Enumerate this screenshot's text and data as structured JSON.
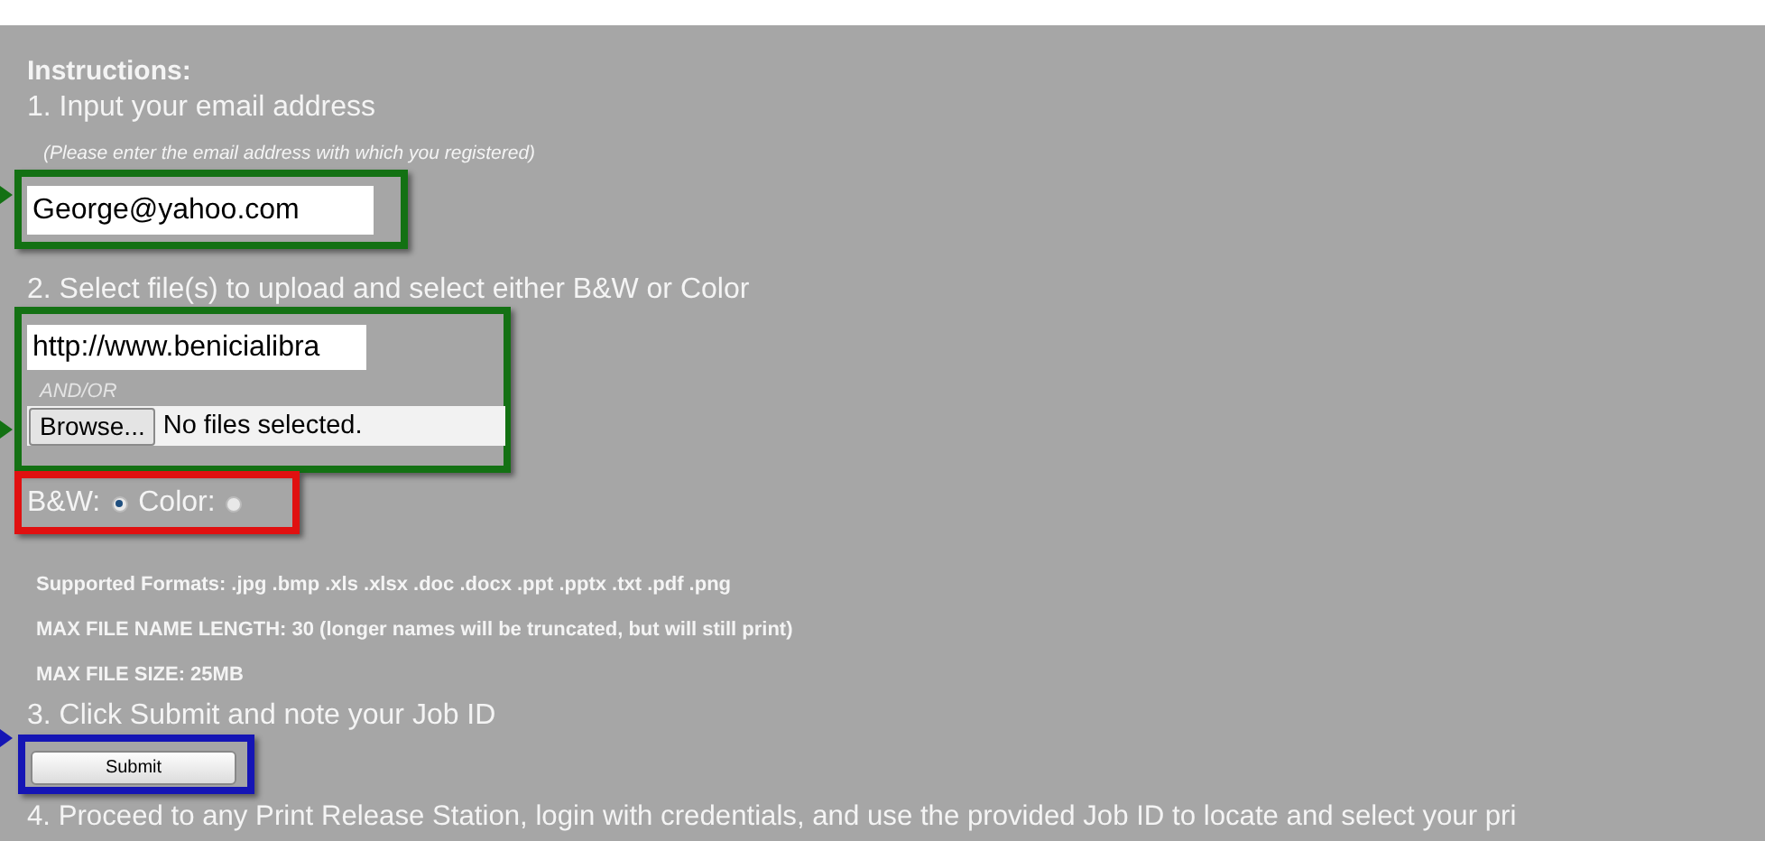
{
  "heading": "Instructions:",
  "email": {
    "step": "1. Input your email address",
    "hint": "(Please enter the email address with which you registered)",
    "value": "George@yahoo.com",
    "highlight": {
      "color": "#137113"
    }
  },
  "files": {
    "step": "2. Select file(s) to upload and select either B&W or Color",
    "url_value": "http://www.benicialibra",
    "separator": "AND/OR",
    "browse_button": "Browse...",
    "file_status": "No files selected.",
    "highlight": {
      "color": "#137113"
    }
  },
  "print_mode": {
    "options": [
      {
        "label": "B&W:",
        "selected": true
      },
      {
        "label": "Color:",
        "selected": false
      }
    ],
    "highlight": {
      "color": "#e01010"
    }
  },
  "notes": [
    "Supported Formats: .jpg .bmp .xls .xlsx .doc .docx .ppt .pptx .txt .pdf .png",
    "MAX FILE NAME LENGTH: 30 (longer names will be truncated, but will still print)",
    "MAX FILE SIZE: 25MB"
  ],
  "submit": {
    "step": "3. Click Submit and note your Job ID",
    "button": "Submit",
    "highlight": {
      "color": "#1515b5"
    }
  },
  "final_step": "4. Proceed to any Print Release Station, login with credentials, and use the provided Job ID to locate and select your pri"
}
